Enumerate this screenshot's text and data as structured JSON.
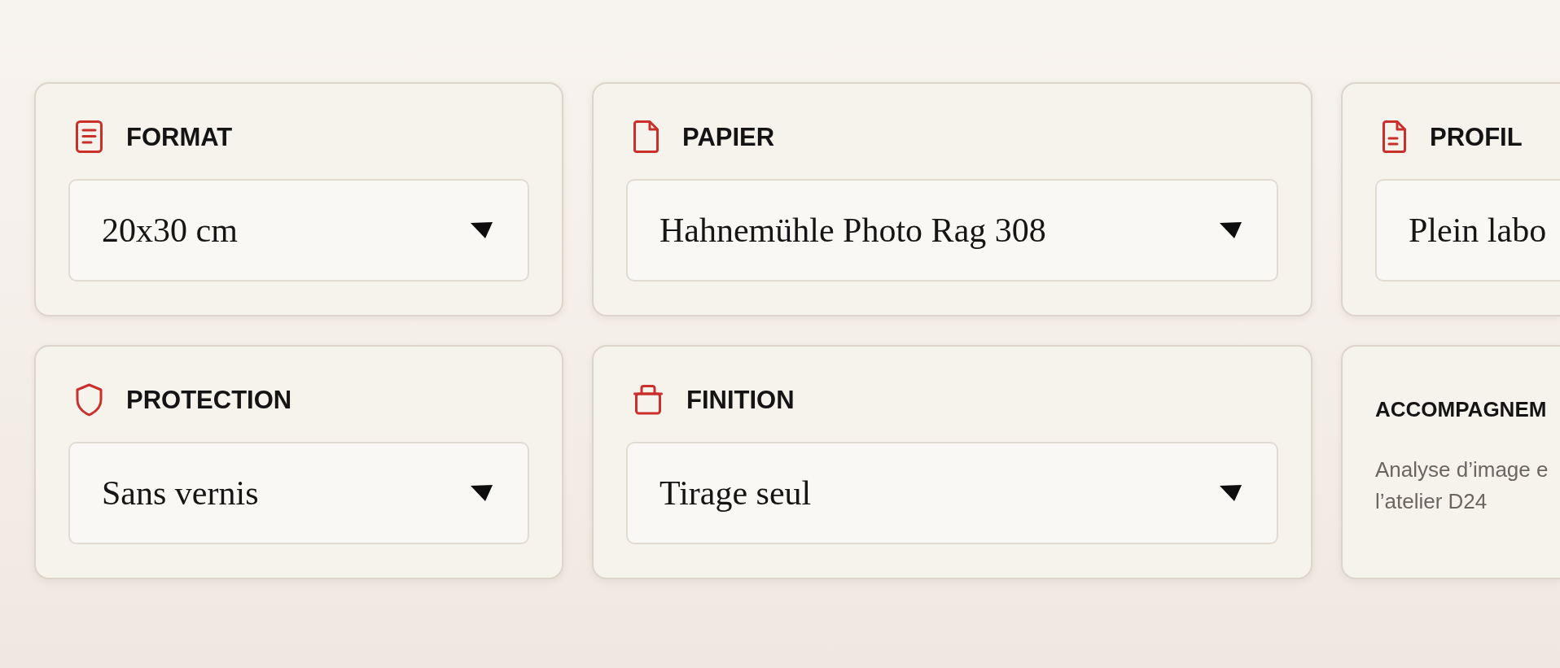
{
  "rows": [
    {
      "cards": [
        {
          "kind": "select",
          "title": "FORMAT",
          "value": "20x30 cm"
        },
        {
          "kind": "select",
          "title": "PAPIER",
          "value": "Hahnemühle Photo Rag 308"
        },
        {
          "kind": "select",
          "title": "PROFIL",
          "value": "Plein labo"
        }
      ]
    },
    {
      "cards": [
        {
          "kind": "select",
          "title": "PROTECTION",
          "value": "Sans vernis"
        },
        {
          "kind": "select",
          "title": "FINITION",
          "value": "Tirage seul"
        },
        {
          "kind": "info",
          "title": "ACCOMPAGNEM",
          "description": "Analyse d’image e\nl’atelier D24"
        }
      ]
    }
  ]
}
